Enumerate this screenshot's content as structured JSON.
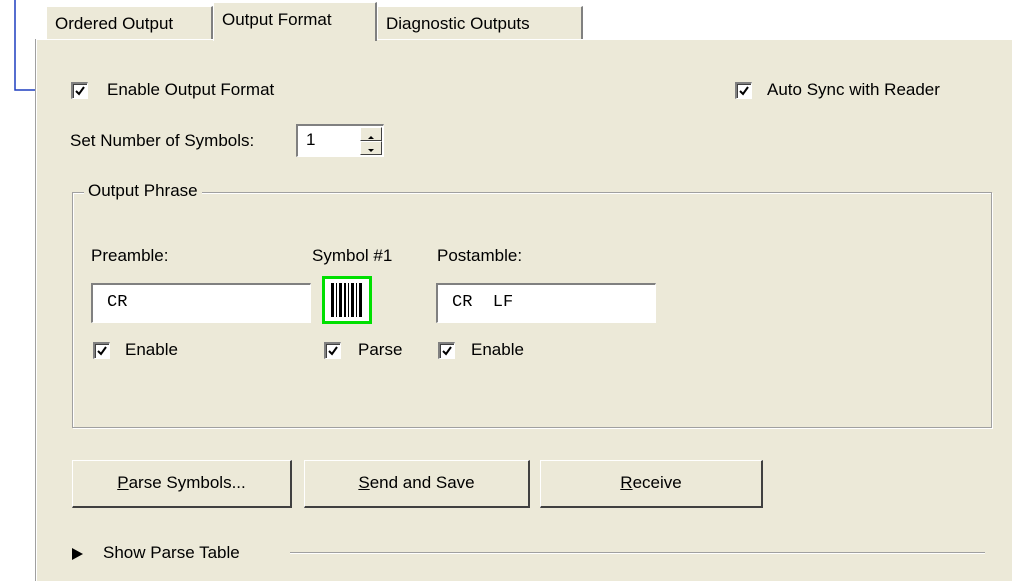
{
  "tabs": [
    {
      "label": "Ordered Output"
    },
    {
      "label": "Output Format"
    },
    {
      "label": "Diagnostic Outputs"
    }
  ],
  "enable_output_format": {
    "label": "Enable Output Format",
    "checked": true
  },
  "auto_sync": {
    "label": "Auto Sync with Reader",
    "checked": true
  },
  "symbols": {
    "label": "Set Number of Symbols:",
    "value": "1"
  },
  "output_phrase": {
    "title": "Output Phrase",
    "preamble": {
      "label": "Preamble:",
      "value": "CR",
      "enable_label": "Enable",
      "enabled": true
    },
    "symbol": {
      "label": "Symbol #1",
      "parse_label": "Parse",
      "parse": true,
      "icon": "barcode-icon",
      "highlight_color": "#00e000"
    },
    "postamble": {
      "label": "Postamble:",
      "value": "CR  LF",
      "enable_label": "Enable",
      "enabled": true
    }
  },
  "buttons": {
    "parse": {
      "mnemonic": "P",
      "rest": "arse Symbols..."
    },
    "send": {
      "mnemonic": "S",
      "rest": "end and Save"
    },
    "receive": {
      "mnemonic": "R",
      "rest": "eceive"
    }
  },
  "parse_table": {
    "label": "Show Parse Table"
  },
  "colors": {
    "callout": "#1f3fbf",
    "window_bg": "#ece9d8"
  }
}
